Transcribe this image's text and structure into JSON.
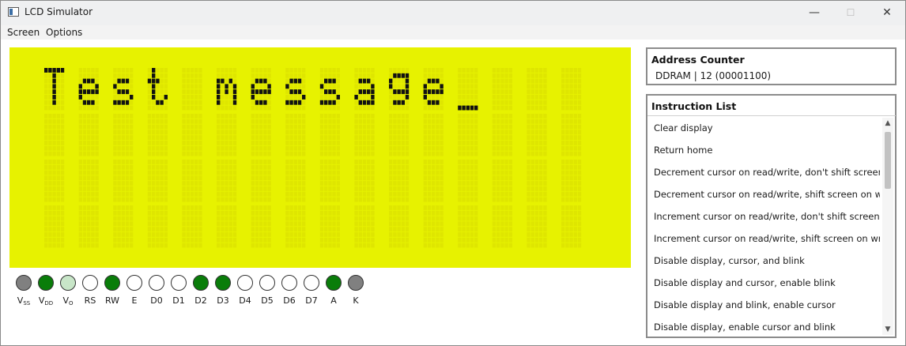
{
  "window": {
    "title": "LCD Simulator",
    "minimize": "—",
    "maximize": "☐",
    "close": "✕"
  },
  "menu": [
    {
      "label": "Screen"
    },
    {
      "label": "Options"
    }
  ],
  "lcd": {
    "rows": [
      "Test message",
      "",
      "",
      ""
    ],
    "cursor": "_",
    "background": "#e7f200",
    "pixel_on": "#111111",
    "pixel_off": "#dfe600"
  },
  "pins": [
    {
      "main": "V",
      "sub": "SS",
      "state": "gray"
    },
    {
      "main": "V",
      "sub": "DD",
      "state": "green"
    },
    {
      "main": "V",
      "sub": "O",
      "state": "light"
    },
    {
      "main": "RS",
      "sub": "",
      "state": "off"
    },
    {
      "main": "RW",
      "sub": "",
      "state": "green"
    },
    {
      "main": "E",
      "sub": "",
      "state": "off"
    },
    {
      "main": "D0",
      "sub": "",
      "state": "off"
    },
    {
      "main": "D1",
      "sub": "",
      "state": "off"
    },
    {
      "main": "D2",
      "sub": "",
      "state": "green"
    },
    {
      "main": "D3",
      "sub": "",
      "state": "green"
    },
    {
      "main": "D4",
      "sub": "",
      "state": "off"
    },
    {
      "main": "D5",
      "sub": "",
      "state": "off"
    },
    {
      "main": "D6",
      "sub": "",
      "state": "off"
    },
    {
      "main": "D7",
      "sub": "",
      "state": "off"
    },
    {
      "main": "A",
      "sub": "",
      "state": "green"
    },
    {
      "main": "K",
      "sub": "",
      "state": "gray"
    }
  ],
  "pin_colors": {
    "gray": "#808080",
    "green": "#0a7d0a",
    "light": "#c8e6c8",
    "off": "#ffffff"
  },
  "address_counter": {
    "title": "Address Counter",
    "value": "DDRAM | 12 (00001100)"
  },
  "instructions": {
    "title": "Instruction List",
    "items": [
      "Clear display",
      "Return home",
      "Decrement cursor on read/write, don't shift screen",
      "Decrement cursor on read/write, shift screen on write",
      "Increment cursor on read/write, don't shift screen",
      "Increment cursor on read/write, shift screen on write",
      "Disable display, cursor, and blink",
      "Disable display and cursor, enable blink",
      "Disable display and blink, enable cursor",
      "Disable display, enable cursor and blink"
    ]
  }
}
